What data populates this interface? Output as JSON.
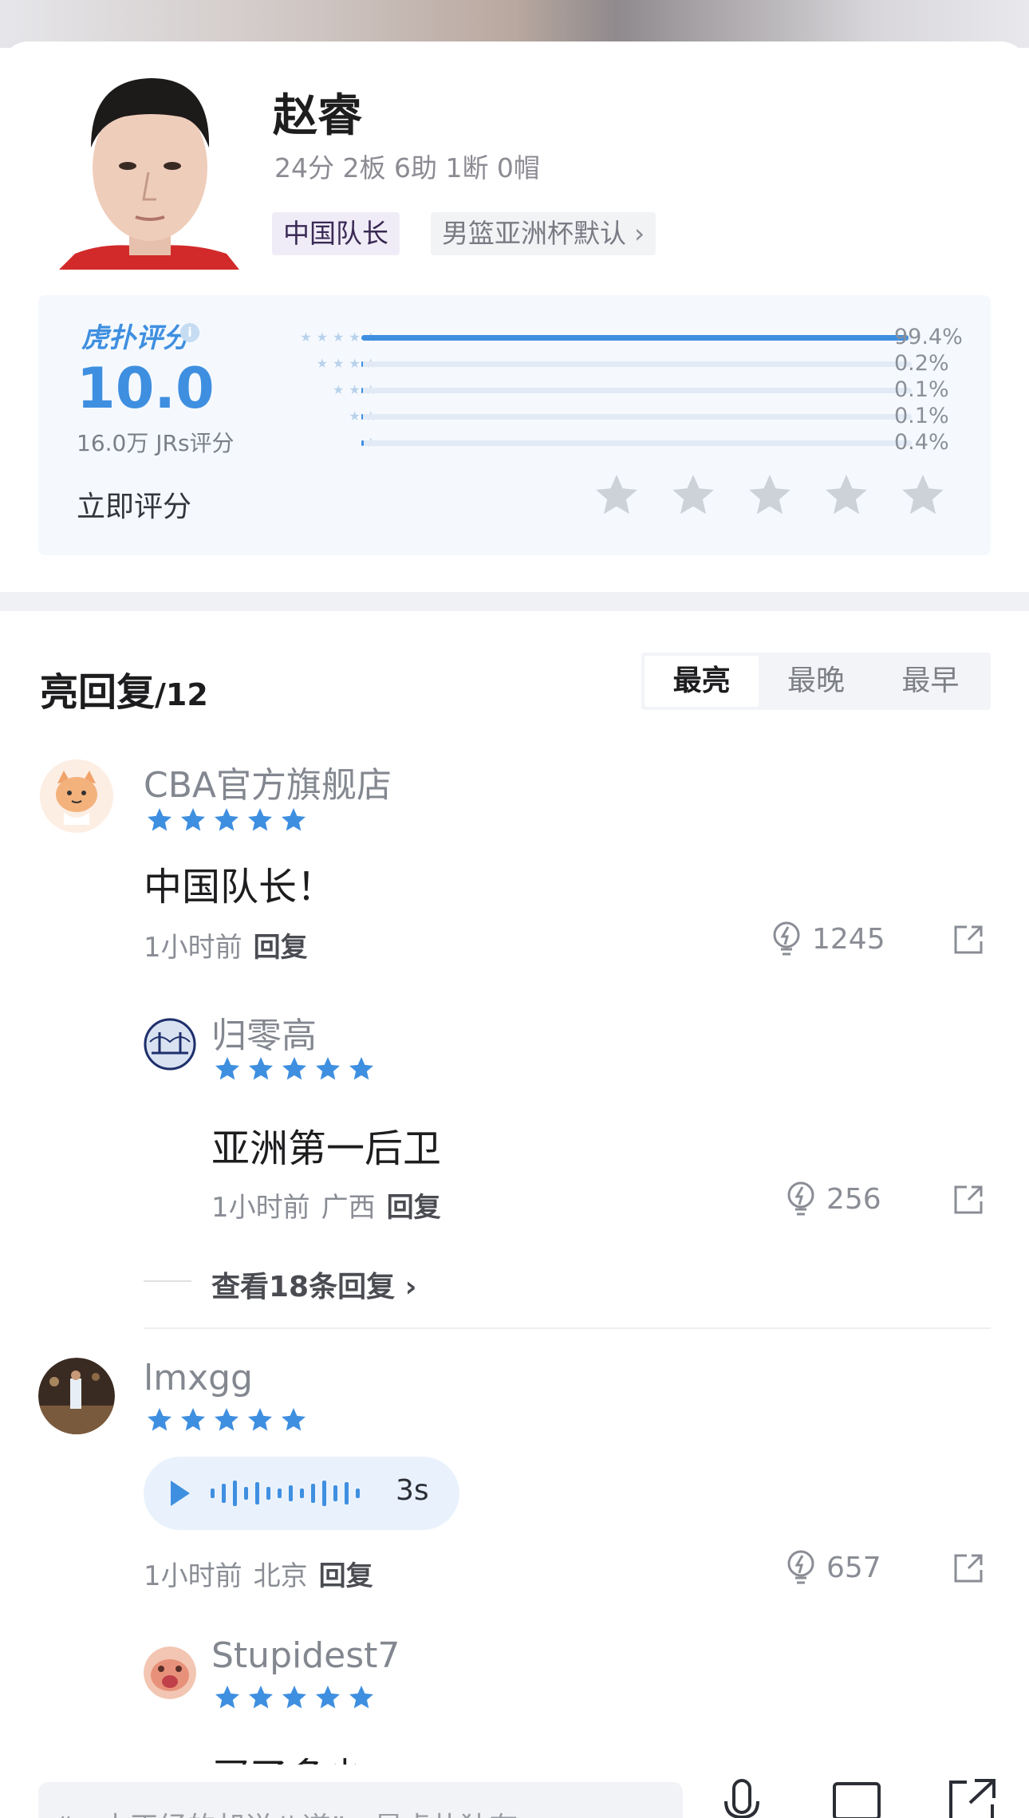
{
  "player": {
    "name": "赵睿",
    "stats": "24分 2板 6助 1断 0帽",
    "tags": [
      "中国队长",
      "男篮亚洲杯默认"
    ]
  },
  "rating": {
    "brand": "虎扑评分",
    "score": "10.0",
    "count_label": "16.0万 JRs评分",
    "distribution": [
      {
        "stars": 5,
        "percent": 99.4,
        "label": "99.4%"
      },
      {
        "stars": 4,
        "percent": 0.2,
        "label": "0.2%"
      },
      {
        "stars": 3,
        "percent": 0.1,
        "label": "0.1%"
      },
      {
        "stars": 2,
        "percent": 0.1,
        "label": "0.1%"
      },
      {
        "stars": 1,
        "percent": 0.4,
        "label": "0.4%"
      }
    ],
    "rate_now_label": "立即评分",
    "accent_color": "#3f8fe0"
  },
  "comments_section": {
    "title": "亮回复",
    "count": "/12",
    "sort_tabs": [
      {
        "label": "最亮",
        "active": true
      },
      {
        "label": "最晚",
        "active": false
      },
      {
        "label": "最早",
        "active": false
      }
    ]
  },
  "comments": [
    {
      "user": "CBA官方旗舰店",
      "stars": 5,
      "text": "中国队长！",
      "time": "1小时前",
      "reply_label": "回复",
      "likes": "1245"
    },
    {
      "user": "归零高",
      "stars": 5,
      "text": "亚洲第一后卫",
      "time": "1小时前",
      "location": "广西",
      "reply_label": "回复",
      "likes": "256",
      "view_more": "查看18条回复"
    },
    {
      "user": "lmxgg",
      "stars": 5,
      "voice_duration": "3s",
      "time": "1小时前",
      "location": "北京",
      "reply_label": "回复",
      "likes": "657"
    },
    {
      "user": "Stupidest7",
      "stars": 5,
      "text": "买了多少"
    }
  ],
  "bottom_bar": {
    "input_placeholder": "“一本正经的胡说八道”，是虎扑独有"
  }
}
